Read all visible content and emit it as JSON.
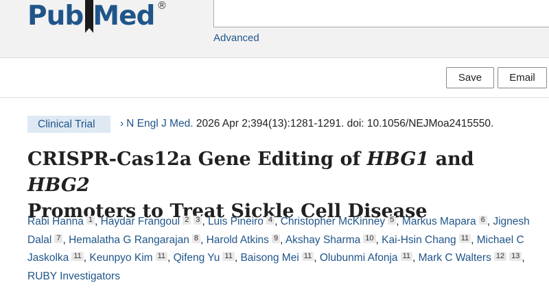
{
  "header": {
    "logo": {
      "pub": "Pub",
      "med": "Med",
      "registered": "®"
    },
    "advanced_link": "Advanced"
  },
  "actions": {
    "save_label": "Save",
    "email_label": "Email"
  },
  "article": {
    "publication_type": "Clinical Trial",
    "citation": {
      "chevron": "›",
      "journal": "N Engl J Med.",
      "details": " 2026 Apr 2;394(13):1281-1291. doi: 10.1056/NEJMoa2415550."
    },
    "title": {
      "line1_part1": "CRISPR-Cas12a Gene Editing of ",
      "gene1": "HBG1",
      "line1_part2": " and ",
      "gene2": "HBG2",
      "line2": "Promoters to Treat Sickle Cell Disease"
    },
    "authors": [
      {
        "name": "Rabi Hanna",
        "aff": [
          "1"
        ]
      },
      {
        "name": "Haydar Frangoul",
        "aff": [
          "2",
          "3"
        ]
      },
      {
        "name": "Luis Pineiro",
        "aff": [
          "4"
        ]
      },
      {
        "name": "Christopher McKinney",
        "aff": [
          "5"
        ]
      },
      {
        "name": "Markus Mapara",
        "aff": [
          "6"
        ]
      },
      {
        "name": "Jignesh Dalal",
        "aff": [
          "7"
        ]
      },
      {
        "name": "Hemalatha G Rangarajan",
        "aff": [
          "8"
        ]
      },
      {
        "name": "Harold Atkins",
        "aff": [
          "9"
        ]
      },
      {
        "name": "Akshay Sharma",
        "aff": [
          "10"
        ]
      },
      {
        "name": "Kai-Hsin Chang",
        "aff": [
          "11"
        ]
      },
      {
        "name": "Michael C Jaskolka",
        "aff": [
          "11"
        ]
      },
      {
        "name": "Keunpyo Kim",
        "aff": [
          "11"
        ]
      },
      {
        "name": "Qifeng Yu",
        "aff": [
          "11"
        ]
      },
      {
        "name": "Baisong Mei",
        "aff": [
          "11"
        ]
      },
      {
        "name": "Olubunmi Afonja",
        "aff": [
          "11"
        ]
      },
      {
        "name": "Mark C Walters",
        "aff": [
          "12",
          "13"
        ]
      },
      {
        "name": "RUBY Investigators",
        "aff": []
      }
    ],
    "separator": ","
  },
  "colors": {
    "brand_blue": "#20558a",
    "tag_bg": "#dfe9f4",
    "header_bg": "#f2f2f2"
  }
}
